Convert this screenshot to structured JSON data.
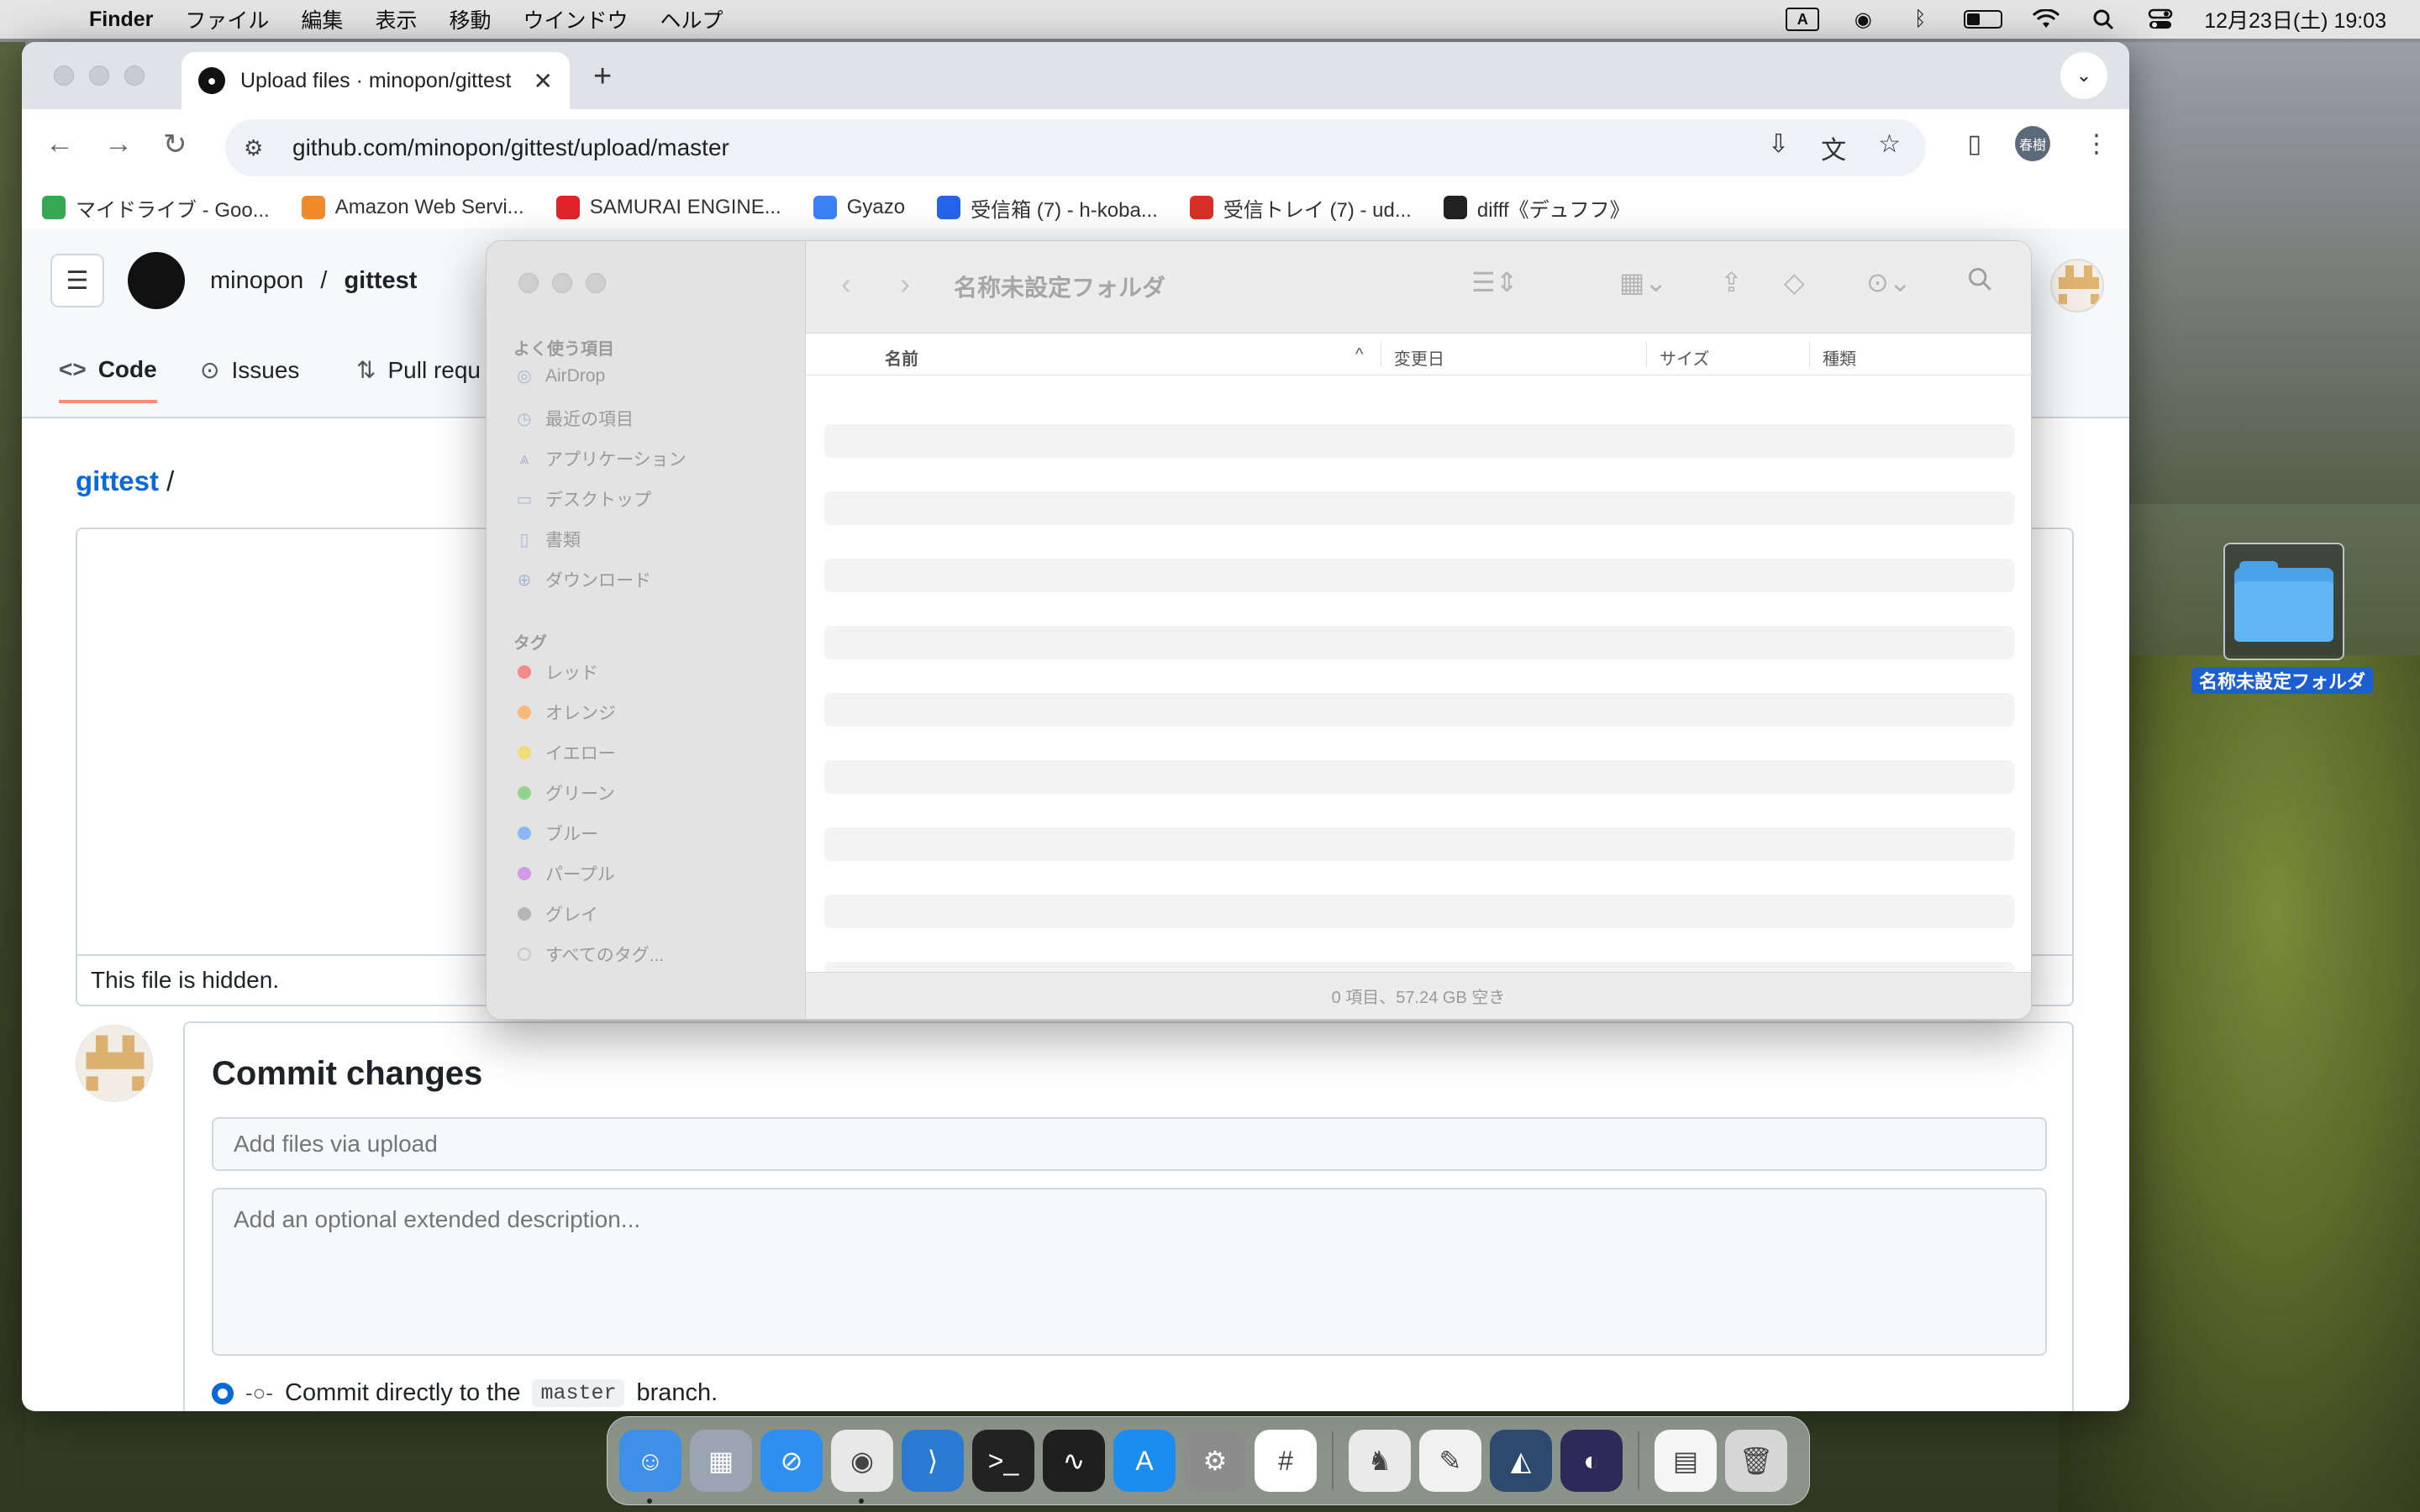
{
  "menubar": {
    "app": "Finder",
    "items": [
      "ファイル",
      "編集",
      "表示",
      "移動",
      "ウインドウ",
      "ヘルプ"
    ],
    "input_indicator": "A",
    "battery_level": 0.4,
    "clock": "12月23日(土) 19:03"
  },
  "browser": {
    "tab_title": "Upload files · minopon/gittest",
    "url": "github.com/minopon/gittest/upload/master",
    "profile_initials": "春樹",
    "bookmarks": [
      {
        "label": "マイドライブ - Goo...",
        "color": "#34a853"
      },
      {
        "label": "Amazon Web Servi...",
        "color": "#f08a2a"
      },
      {
        "label": "SAMURAI ENGINE...",
        "color": "#e0242a"
      },
      {
        "label": "Gyazo",
        "color": "#3b82f6"
      },
      {
        "label": "受信箱 (7) - h-koba...",
        "color": "#2563eb"
      },
      {
        "label": "受信トレイ (7) - ud...",
        "color": "#d93025"
      },
      {
        "label": "difff《デュフフ》",
        "color": "#222222"
      }
    ]
  },
  "github": {
    "owner": "minopon",
    "separator": "/",
    "repo": "gittest",
    "nav": {
      "code": "Code",
      "issues": "Issues",
      "pulls": "Pull requ"
    },
    "breadcrumb_repo": "gittest",
    "breadcrumb_sep": "/",
    "hidden_notice": "This file is hidden.",
    "commit": {
      "title": "Commit changes",
      "summary_placeholder": "Add files via upload",
      "description_placeholder": "Add an optional extended description...",
      "direct_prefix": "Commit directly to the",
      "branch": "master",
      "direct_suffix": "branch."
    }
  },
  "finder": {
    "title": "名称未設定フォルダ",
    "favorites_header": "よく使う項目",
    "favorites": [
      {
        "label": "AirDrop",
        "icon": "airdrop-icon"
      },
      {
        "label": "最近の項目",
        "icon": "clock-icon"
      },
      {
        "label": "アプリケーション",
        "icon": "applications-icon"
      },
      {
        "label": "デスクトップ",
        "icon": "desktop-icon"
      },
      {
        "label": "書類",
        "icon": "document-icon"
      },
      {
        "label": "ダウンロード",
        "icon": "download-icon"
      }
    ],
    "tags_header": "タグ",
    "tags": [
      {
        "label": "レッド",
        "color": "#f28b8b"
      },
      {
        "label": "オレンジ",
        "color": "#f5b97a"
      },
      {
        "label": "イエロー",
        "color": "#f2dc7a"
      },
      {
        "label": "グリーン",
        "color": "#8fd48f"
      },
      {
        "label": "ブルー",
        "color": "#8ab8f2"
      },
      {
        "label": "パープル",
        "color": "#cf9ae6"
      },
      {
        "label": "グレイ",
        "color": "#b5b5b5"
      },
      {
        "label": "すべてのタグ...",
        "color": "#e3e3e3"
      }
    ],
    "columns": {
      "name": "名前",
      "modified": "変更日",
      "size": "サイズ",
      "kind": "種類"
    },
    "status": "0 項目、57.24 GB 空き"
  },
  "desktop": {
    "folder_label": "名称未設定フォルダ"
  },
  "dock": {
    "apps": [
      {
        "name": "finder",
        "color": "#3d8fe8",
        "running": true
      },
      {
        "name": "launchpad",
        "color": "#9aa4b2",
        "running": false
      },
      {
        "name": "safari",
        "color": "#2f8ff0",
        "running": false
      },
      {
        "name": "chrome",
        "color": "#e8e8e8",
        "running": true
      },
      {
        "name": "vscode",
        "color": "#2a7ad4",
        "running": false
      },
      {
        "name": "terminal",
        "color": "#222222",
        "running": false
      },
      {
        "name": "activity-monitor",
        "color": "#1f1f1f",
        "running": false
      },
      {
        "name": "app-store",
        "color": "#1b8cf0",
        "running": false
      },
      {
        "name": "system-settings",
        "color": "#8c8c8c",
        "running": false
      },
      {
        "name": "slack",
        "color": "#ffffff",
        "running": false
      },
      {
        "name": "tableplus",
        "color": "#eaeaea",
        "running": false
      },
      {
        "name": "textedit",
        "color": "#f1f1f1",
        "running": false
      },
      {
        "name": "mysql-workbench",
        "color": "#2b4a6e",
        "running": false
      },
      {
        "name": "eclipse",
        "color": "#2d2a5a",
        "running": false
      },
      {
        "name": "document",
        "color": "#f5f5f5",
        "running": false
      },
      {
        "name": "trash",
        "color": "#d6d6d6",
        "running": false
      }
    ]
  }
}
